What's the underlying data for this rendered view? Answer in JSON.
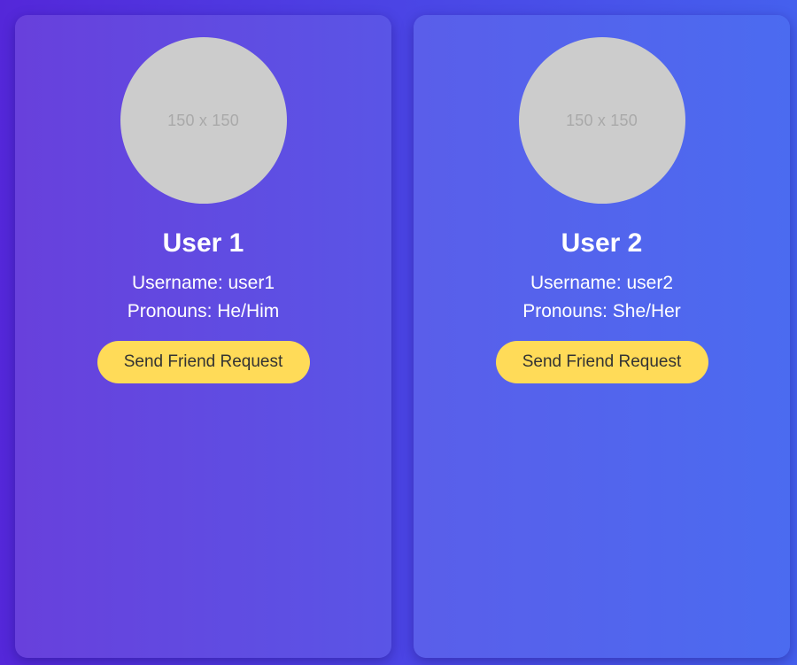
{
  "users": [
    {
      "avatar_placeholder": "150 x 150",
      "name": "User 1",
      "username_text": "Username: user1",
      "pronouns_text": "Pronouns: He/Him",
      "button_label": "Send Friend Request"
    },
    {
      "avatar_placeholder": "150 x 150",
      "name": "User 2",
      "username_text": "Username: user2",
      "pronouns_text": "Pronouns: She/Her",
      "button_label": "Send Friend Request"
    }
  ],
  "colors": {
    "background_start": "#5427d9",
    "background_end": "#4560ee",
    "avatar_placeholder_bg": "#cccccc",
    "button_bg": "#ffdb58",
    "button_text": "#333333"
  }
}
